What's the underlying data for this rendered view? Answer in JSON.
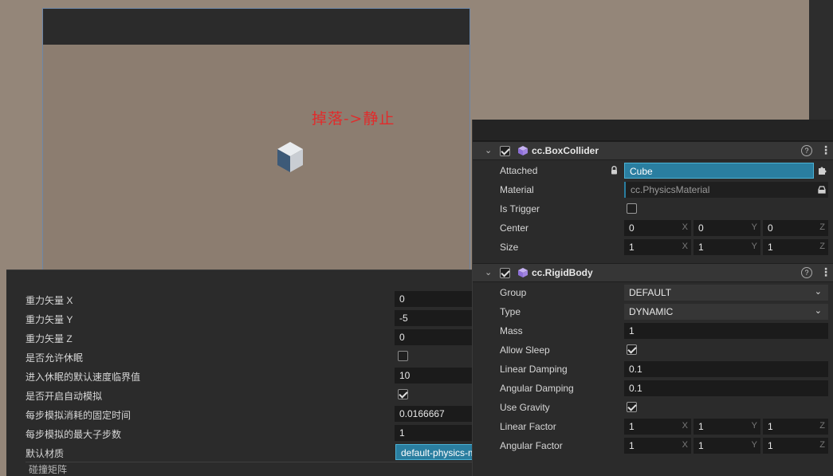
{
  "preview": {
    "label": "掉落->静止"
  },
  "physics_settings": {
    "rows": [
      {
        "label": "重力矢量 X",
        "value": "0"
      },
      {
        "label": "重力矢量 Y",
        "value": "-5"
      },
      {
        "label": "重力矢量 Z",
        "value": "0"
      },
      {
        "label": "是否允许休眠",
        "checked": false
      },
      {
        "label": "进入休眠的默认速度临界值",
        "value": "10"
      },
      {
        "label": "是否开启自动模拟",
        "checked": true
      },
      {
        "label": "每步模拟消耗的固定时间",
        "value": "0.0166667"
      },
      {
        "label": "每步模拟的最大子步数",
        "value": "1"
      },
      {
        "label": "默认材质",
        "value": "default-physics-material"
      }
    ],
    "footer": "碰撞矩阵"
  },
  "inspector": {
    "box_collider": {
      "title": "cc.BoxCollider",
      "enabled": true,
      "attached_label": "Attached",
      "attached_value": "Cube",
      "material_label": "Material",
      "material_value": "cc.PhysicsMaterial",
      "is_trigger_label": "Is Trigger",
      "is_trigger": false,
      "center_label": "Center",
      "center": {
        "x": "0",
        "y": "0",
        "z": "0"
      },
      "size_label": "Size",
      "size": {
        "x": "1",
        "y": "1",
        "z": "1"
      }
    },
    "rigid_body": {
      "title": "cc.RigidBody",
      "enabled": true,
      "group_label": "Group",
      "group_value": "DEFAULT",
      "type_label": "Type",
      "type_value": "DYNAMIC",
      "mass_label": "Mass",
      "mass_value": "1",
      "allow_sleep_label": "Allow Sleep",
      "allow_sleep": true,
      "linear_damping_label": "Linear Damping",
      "linear_damping_value": "0.1",
      "angular_damping_label": "Angular Damping",
      "angular_damping_value": "0.1",
      "use_gravity_label": "Use Gravity",
      "use_gravity": true,
      "linear_factor_label": "Linear Factor",
      "linear_factor": {
        "x": "1",
        "y": "1",
        "z": "1"
      },
      "angular_factor_label": "Angular Factor",
      "angular_factor": {
        "x": "1",
        "y": "1",
        "z": "1"
      }
    },
    "axis_labels": {
      "x": "X",
      "y": "Y",
      "z": "Z"
    },
    "help_glyph": "?",
    "more_glyph": "⋮",
    "expand_glyph": "⌄",
    "dropdown_glyph": "⌄"
  },
  "colors": {
    "viewport_bg": "#948679",
    "panel_bg": "#2b2b2b",
    "accent": "#2a7ea0",
    "label_red": "#e12b2b",
    "component_icon": "#a184e0"
  }
}
